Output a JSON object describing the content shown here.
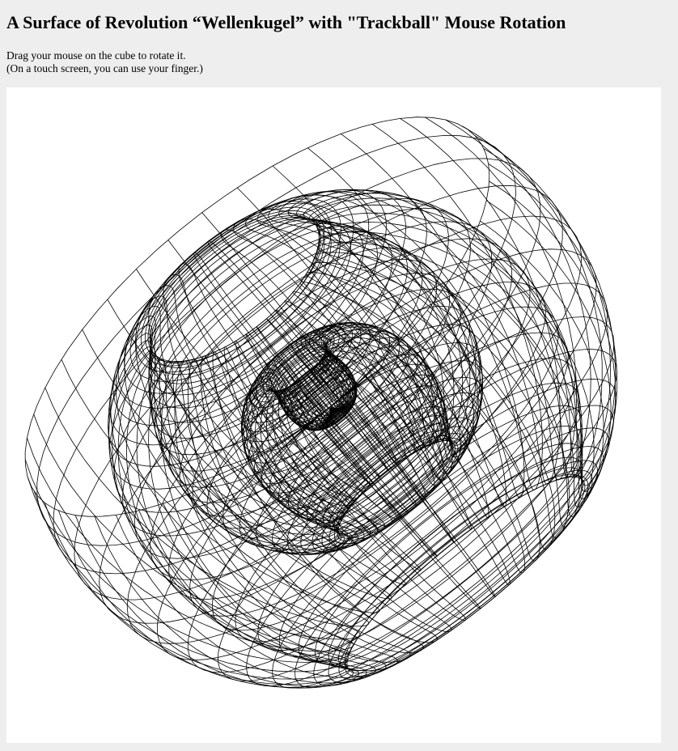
{
  "page": {
    "title": "A Surface of Revolution “Wellenkugel” with \"Trackball\" Mouse Rotation",
    "instructions": [
      "Drag your mouse on the cube to rotate it.",
      "(On a touch screen, you can use your finger.)"
    ]
  },
  "canvas": {
    "background": "#ffffff",
    "stroke_color": "#000000"
  }
}
